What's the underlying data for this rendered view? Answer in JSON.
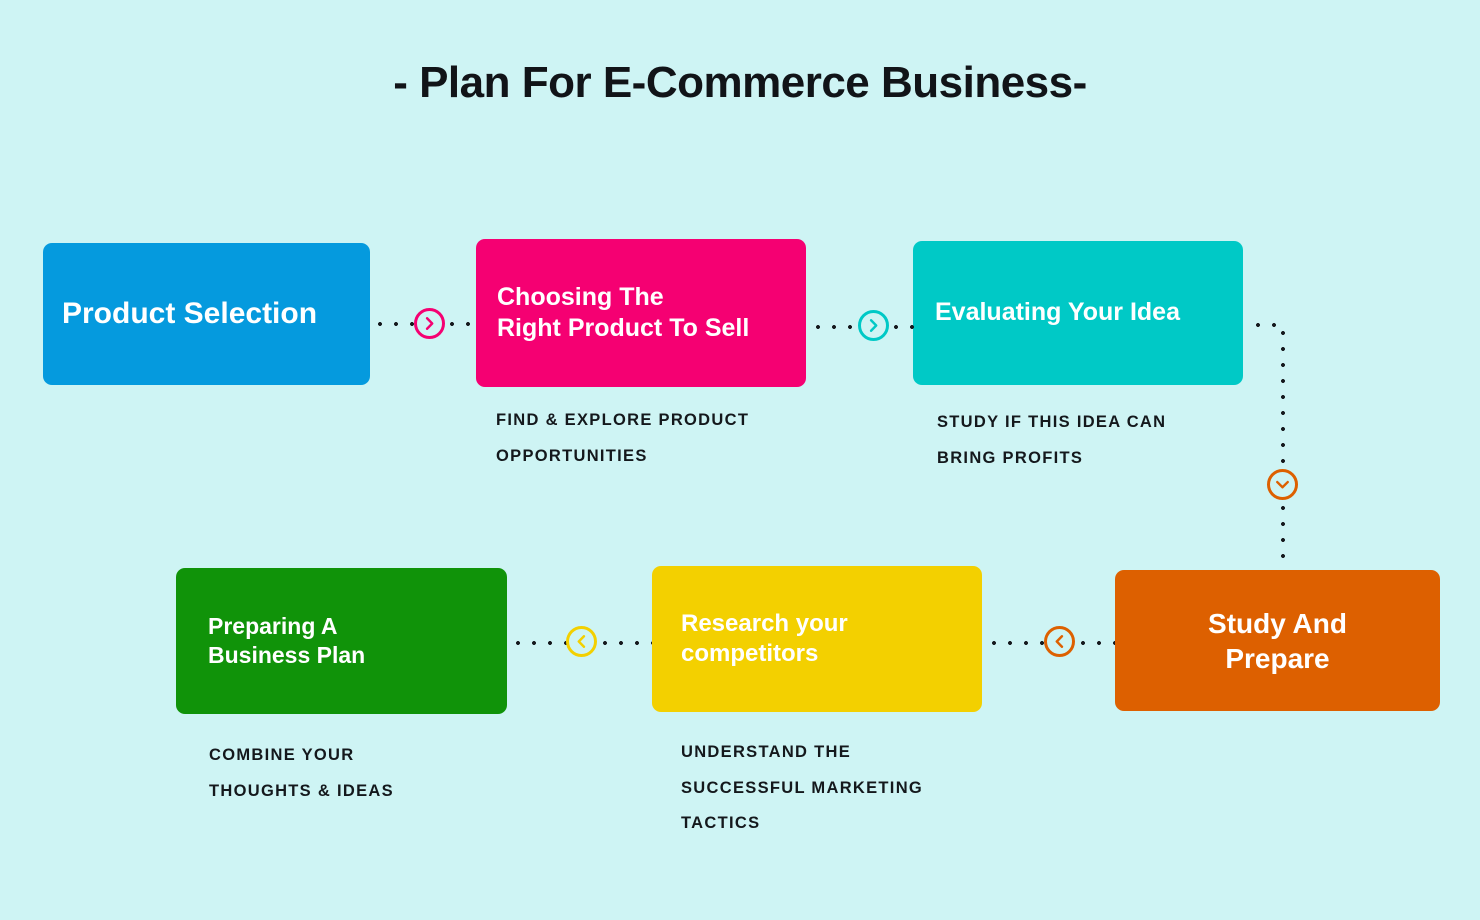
{
  "page": {
    "title": "- Plan For E-Commerce Business-",
    "background_color": "#cef4f4",
    "text_color": "#14181c"
  },
  "steps": [
    {
      "id": "product-selection",
      "label": "Product Selection",
      "caption": "",
      "color": "#059ade",
      "color_name": "blue",
      "row": 1,
      "order": 1
    },
    {
      "id": "choosing-right-product",
      "label": "Choosing The\nRight Product To Sell",
      "caption": "FIND & EXPLORE PRODUCT\nOPPORTUNITIES",
      "color": "#f50072",
      "color_name": "pink",
      "row": 1,
      "order": 2
    },
    {
      "id": "evaluating-your-idea",
      "label": "Evaluating Your Idea",
      "caption": "STUDY IF THIS IDEA CAN\nBRING PROFITS",
      "color": "#00c9c6",
      "color_name": "teal",
      "row": 1,
      "order": 3
    },
    {
      "id": "preparing-business-plan",
      "label": "Preparing A\nBusiness Plan",
      "caption": "COMBINE YOUR\nTHOUGHTS & IDEAS",
      "color": "#109309",
      "color_name": "green",
      "row": 2,
      "order": 6
    },
    {
      "id": "research-your-competitors",
      "label": "Research your\ncompetitors",
      "caption": "UNDERSTAND THE\nSUCCESSFUL MARKETING\nTACTICS",
      "color": "#f3d000",
      "color_name": "yellow",
      "row": 2,
      "order": 5
    },
    {
      "id": "study-and-prepare",
      "label": "Study And\nPrepare",
      "caption": "",
      "color": "#dd6000",
      "color_name": "orange",
      "row": 2,
      "order": 4
    }
  ],
  "connectors": [
    {
      "id": "blue-to-pink",
      "icon": "chevron-right-icon",
      "direction": "right",
      "color": "#f50072"
    },
    {
      "id": "pink-to-teal",
      "icon": "chevron-right-icon",
      "direction": "right",
      "color": "#00c9c6"
    },
    {
      "id": "teal-to-orange",
      "icon": "chevron-down-icon",
      "direction": "down",
      "color": "#dd6000"
    },
    {
      "id": "orange-to-yellow",
      "icon": "chevron-left-icon",
      "direction": "left",
      "color": "#dd6000"
    },
    {
      "id": "yellow-to-green",
      "icon": "chevron-left-icon",
      "direction": "left",
      "color": "#f3d000"
    }
  ]
}
